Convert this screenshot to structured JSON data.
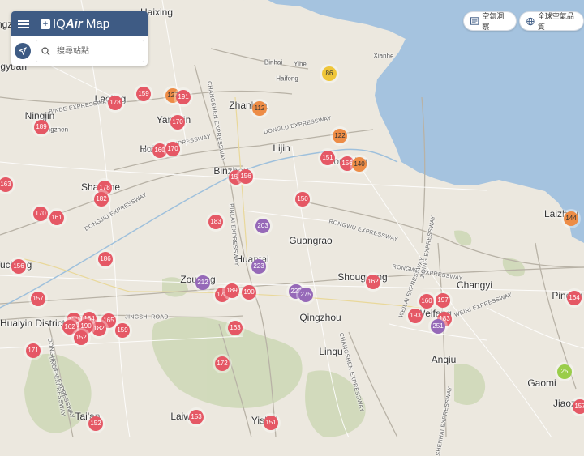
{
  "app": {
    "menu_icon": "hamburger-menu-icon",
    "logo_prefix": "IQ",
    "logo_brand": "Air",
    "logo_suffix": " Map",
    "search_placeholder": "搜尋站點",
    "locate_icon": "location-arrow-icon",
    "search_icon": "search-icon"
  },
  "top_buttons": {
    "insights_label": "空氣洞察",
    "insights_icon": "newspaper-icon",
    "ranking_label": "全球空氣品質",
    "ranking_icon": "globe-icon"
  },
  "colors": {
    "unhealthy": "#e55865",
    "unhealthy_sensitive": "#ed8c46",
    "moderate": "#efc63a",
    "very_unhealthy": "#9669b8",
    "good": "#9acd4a",
    "brand": "#3e5b84",
    "sea": "#a5c3df",
    "land": "#ece8df"
  },
  "places": [
    {
      "name": "Haixing",
      "cls": "city"
    },
    {
      "name": "Binhai",
      "cls": "small"
    },
    {
      "name": "Yihe",
      "cls": "small"
    },
    {
      "name": "Haifeng",
      "cls": "small"
    },
    {
      "name": "Xianhe",
      "cls": "small"
    },
    {
      "name": "Laoling",
      "cls": "city"
    },
    {
      "name": "Ningjin",
      "cls": "city"
    },
    {
      "name": "Kongzhen",
      "cls": "small"
    },
    {
      "name": "Yangxin",
      "cls": "city"
    },
    {
      "name": "Zhanhua",
      "cls": "city"
    },
    {
      "name": "Huimin",
      "cls": "city"
    },
    {
      "name": "Lijin",
      "cls": "city"
    },
    {
      "name": "Dongying",
      "cls": "city"
    },
    {
      "name": "Binzhou",
      "cls": "city"
    },
    {
      "name": "Shanghe",
      "cls": "city"
    },
    {
      "name": "Guangrao",
      "cls": "city"
    },
    {
      "name": "Laizhou",
      "cls": "city"
    },
    {
      "name": "Huantai",
      "cls": "city"
    },
    {
      "name": "Shouguang",
      "cls": "city"
    },
    {
      "name": "Changyi",
      "cls": "city"
    },
    {
      "name": "Zouping",
      "cls": "city"
    },
    {
      "name": "Qingzhou",
      "cls": "city"
    },
    {
      "name": "Weifang",
      "cls": "city"
    },
    {
      "name": "Pingdu",
      "cls": "city"
    },
    {
      "name": "Huaiyin District",
      "cls": "city"
    },
    {
      "name": "Linqu",
      "cls": "city"
    },
    {
      "name": "Anqiu",
      "cls": "city"
    },
    {
      "name": "Gaomi",
      "cls": "city"
    },
    {
      "name": "Tai'an",
      "cls": "city"
    },
    {
      "name": "Laiwu",
      "cls": "city"
    },
    {
      "name": "Yishui",
      "cls": "city"
    },
    {
      "name": "Jiaozhou",
      "cls": "city"
    },
    {
      "name": "Cangzhou",
      "cls": "city"
    },
    {
      "name": "Yucheng",
      "cls": "city"
    },
    {
      "name": "Pingyuan",
      "cls": "city"
    },
    {
      "name": "BINDE EXPRESSWAY",
      "cls": "road"
    },
    {
      "name": "CHANGSHEN EXPRESSWAY",
      "cls": "road"
    },
    {
      "name": "DONGLU EXPRESSWAY",
      "cls": "road"
    },
    {
      "name": "DONGYU EXPRESSWAY",
      "cls": "road"
    },
    {
      "name": "DONGJIU EXPRESSWAY",
      "cls": "road"
    },
    {
      "name": "BINLAI EXPRESSWAY",
      "cls": "road"
    },
    {
      "name": "RONGWU EXPRESSWAY",
      "cls": "road"
    },
    {
      "name": "RONGWU EXPRESSWAY",
      "cls": "road"
    },
    {
      "name": "JIQING EXPRESSWAY",
      "cls": "road"
    },
    {
      "name": "JINGSHI ROAD",
      "cls": "road"
    },
    {
      "name": "CHANGSHEN EXPRESSWAY",
      "cls": "road"
    },
    {
      "name": "DONGHONG EXPRESSWAY",
      "cls": "road"
    },
    {
      "name": "WEILAI EXPRESSWAY",
      "cls": "road"
    },
    {
      "name": "WEIRI EXPRESSWAY",
      "cls": "road"
    },
    {
      "name": "SHENHAI EXPRESSWAY",
      "cls": "road"
    },
    {
      "name": "JINGTAI EXPRESSWAY",
      "cls": "road"
    }
  ],
  "stations": [
    {
      "aqi": 86,
      "level": "moderate"
    },
    {
      "aqi": 127,
      "level": "unhealthy_sensitive"
    },
    {
      "aqi": 191,
      "level": "unhealthy"
    },
    {
      "aqi": 159,
      "level": "unhealthy"
    },
    {
      "aqi": 178,
      "level": "unhealthy"
    },
    {
      "aqi": 112,
      "level": "unhealthy_sensitive"
    },
    {
      "aqi": 189,
      "level": "unhealthy"
    },
    {
      "aqi": 170,
      "level": "unhealthy"
    },
    {
      "aqi": 122,
      "level": "unhealthy_sensitive"
    },
    {
      "aqi": 160,
      "level": "unhealthy"
    },
    {
      "aqi": 170,
      "level": "unhealthy"
    },
    {
      "aqi": 151,
      "level": "unhealthy"
    },
    {
      "aqi": 156,
      "level": "unhealthy"
    },
    {
      "aqi": 140,
      "level": "unhealthy_sensitive"
    },
    {
      "aqi": 163,
      "level": "unhealthy"
    },
    {
      "aqi": 156,
      "level": "unhealthy"
    },
    {
      "aqi": 156,
      "level": "unhealthy"
    },
    {
      "aqi": 178,
      "level": "unhealthy"
    },
    {
      "aqi": 182,
      "level": "unhealthy"
    },
    {
      "aqi": 150,
      "level": "unhealthy"
    },
    {
      "aqi": 170,
      "level": "unhealthy"
    },
    {
      "aqi": 161,
      "level": "unhealthy"
    },
    {
      "aqi": 183,
      "level": "unhealthy"
    },
    {
      "aqi": 203,
      "level": "very_unhealthy"
    },
    {
      "aqi": 144,
      "level": "unhealthy_sensitive"
    },
    {
      "aqi": 186,
      "level": "unhealthy"
    },
    {
      "aqi": 156,
      "level": "unhealthy"
    },
    {
      "aqi": 223,
      "level": "very_unhealthy"
    },
    {
      "aqi": 212,
      "level": "very_unhealthy"
    },
    {
      "aqi": 178,
      "level": "unhealthy"
    },
    {
      "aqi": 189,
      "level": "unhealthy"
    },
    {
      "aqi": 190,
      "level": "unhealthy"
    },
    {
      "aqi": 222,
      "level": "very_unhealthy"
    },
    {
      "aqi": 275,
      "level": "very_unhealthy"
    },
    {
      "aqi": 162,
      "level": "unhealthy"
    },
    {
      "aqi": 157,
      "level": "unhealthy"
    },
    {
      "aqi": 160,
      "level": "unhealthy"
    },
    {
      "aqi": 197,
      "level": "unhealthy"
    },
    {
      "aqi": 164,
      "level": "unhealthy"
    },
    {
      "aqi": 160,
      "level": "unhealthy"
    },
    {
      "aqi": 160,
      "level": "unhealthy"
    },
    {
      "aqi": 164,
      "level": "unhealthy"
    },
    {
      "aqi": 165,
      "level": "unhealthy"
    },
    {
      "aqi": 182,
      "level": "unhealthy"
    },
    {
      "aqi": 190,
      "level": "unhealthy"
    },
    {
      "aqi": 162,
      "level": "unhealthy"
    },
    {
      "aqi": 159,
      "level": "unhealthy"
    },
    {
      "aqi": 152,
      "level": "unhealthy"
    },
    {
      "aqi": 163,
      "level": "unhealthy"
    },
    {
      "aqi": 193,
      "level": "unhealthy"
    },
    {
      "aqi": 183,
      "level": "unhealthy"
    },
    {
      "aqi": 251,
      "level": "very_unhealthy"
    },
    {
      "aqi": 171,
      "level": "unhealthy"
    },
    {
      "aqi": 172,
      "level": "unhealthy"
    },
    {
      "aqi": 25,
      "level": "good"
    },
    {
      "aqi": 152,
      "level": "unhealthy"
    },
    {
      "aqi": 153,
      "level": "unhealthy"
    },
    {
      "aqi": 151,
      "level": "unhealthy"
    },
    {
      "aqi": 157,
      "level": "unhealthy"
    }
  ]
}
